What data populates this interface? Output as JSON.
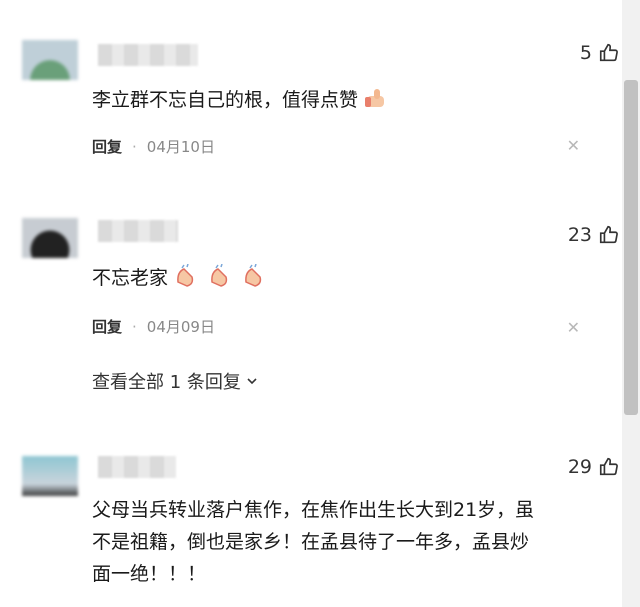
{
  "comments": [
    {
      "likes": "5",
      "text": "李立群不忘自己的根，值得点赞",
      "reply_label": "回复",
      "separator": "·",
      "date": "04月10日"
    },
    {
      "likes": "23",
      "text": "不忘老家",
      "reply_label": "回复",
      "separator": "·",
      "date": "04月09日"
    },
    {
      "likes": "29",
      "text_line1": "父母当兵转业落户焦作，在焦作出生长大到21岁，虽",
      "text_line2": "不是祖籍，倒也是家乡！在孟县待了一年多，孟县炒",
      "text_line3": "面一绝！！！"
    }
  ],
  "view_all_replies": "查看全部 1 条回复",
  "icons": {
    "like": "thumbs-up-icon",
    "close": "close-icon",
    "chevron": "chevron-down-icon",
    "emoji_thumb": "thumbs-up-emoji",
    "emoji_clap": "clap-emoji"
  },
  "colors": {
    "text": "#1a1a1a",
    "meta": "#888888",
    "scrollbar": "#c1c1c1"
  }
}
